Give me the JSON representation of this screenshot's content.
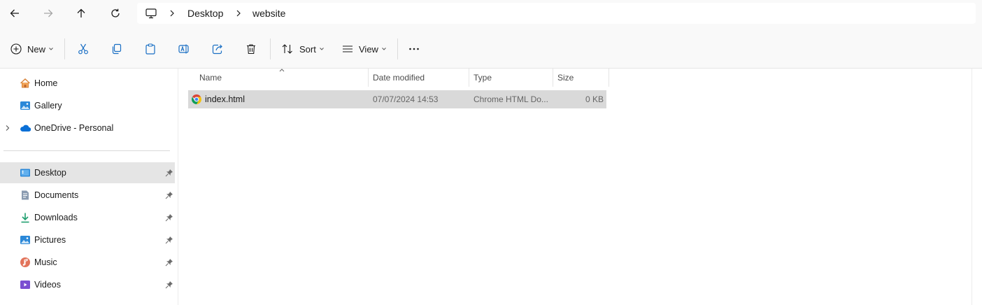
{
  "address_bar": {
    "breadcrumbs": [
      "Desktop",
      "website"
    ]
  },
  "toolbar": {
    "new_label": "New",
    "sort_label": "Sort",
    "view_label": "View"
  },
  "sidebar": {
    "quick": [
      {
        "label": "Home",
        "icon": "home-icon"
      },
      {
        "label": "Gallery",
        "icon": "gallery-icon"
      },
      {
        "label": "OneDrive - Personal",
        "icon": "onedrive-icon"
      }
    ],
    "pinned": [
      {
        "label": "Desktop",
        "icon": "desktop-icon",
        "selected": true
      },
      {
        "label": "Documents",
        "icon": "documents-icon"
      },
      {
        "label": "Downloads",
        "icon": "downloads-icon"
      },
      {
        "label": "Pictures",
        "icon": "pictures-icon"
      },
      {
        "label": "Music",
        "icon": "music-icon"
      },
      {
        "label": "Videos",
        "icon": "videos-icon"
      }
    ]
  },
  "file_list": {
    "columns": [
      "Name",
      "Date modified",
      "Type",
      "Size"
    ],
    "rows": [
      {
        "name": "index.html",
        "date_modified": "07/07/2024 14:53",
        "type": "Chrome HTML Do...",
        "size": "0 KB",
        "icon": "chrome-icon"
      }
    ]
  },
  "colors": {
    "selected_row": "#d9d9d9",
    "selected_nav": "#e5e5e5",
    "chrome_red": "#db4437",
    "chrome_yellow": "#f4c20d",
    "chrome_green": "#0f9d58",
    "chrome_blue": "#4285f4"
  }
}
